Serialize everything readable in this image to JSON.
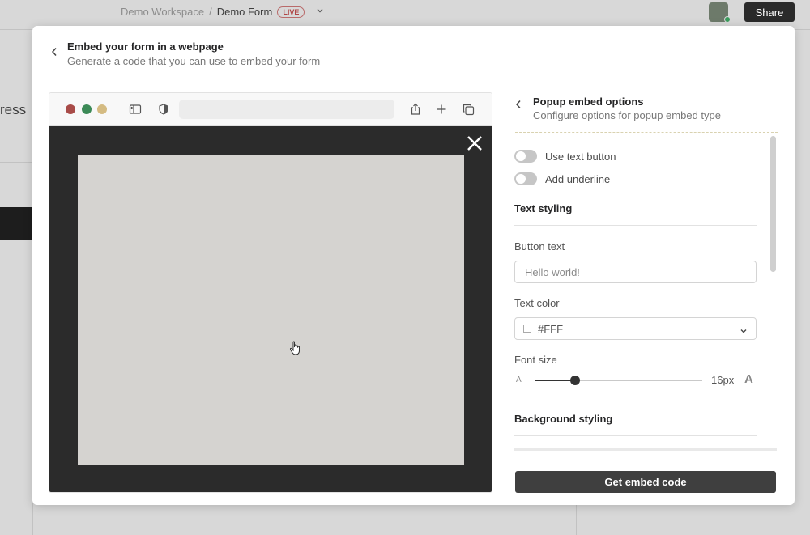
{
  "background": {
    "workspace": "Demo Workspace",
    "separator": "/",
    "form_name": "Demo Form",
    "live_badge": "LIVE",
    "share_label": "Share",
    "partial_text": "ress"
  },
  "modal": {
    "title": "Embed your form in a webpage",
    "subtitle": "Generate a code that you can use to embed your form"
  },
  "panel": {
    "title": "Popup embed options",
    "subtitle": "Configure options for popup embed type",
    "toggles": [
      {
        "label": "Use text button",
        "on": false
      },
      {
        "label": "Add underline",
        "on": false
      }
    ],
    "text_styling_title": "Text styling",
    "button_text_label": "Button text",
    "button_text_placeholder": "Hello world!",
    "text_color_label": "Text color",
    "text_color_value": "#FFF",
    "font_size_label": "Font size",
    "font_size_value": "16px",
    "font_size_fraction": 0.24,
    "font_size_small_glyph": "A",
    "font_size_large_glyph": "A",
    "background_styling_title": "Background styling"
  },
  "actions": {
    "get_embed_code": "Get embed code"
  },
  "colors": {
    "accent_dark": "#3f3f3f",
    "live_red": "#b04545",
    "traffic_red": "#a84b48",
    "traffic_green": "#3c8a57",
    "traffic_yellow": "#d4bb82"
  }
}
